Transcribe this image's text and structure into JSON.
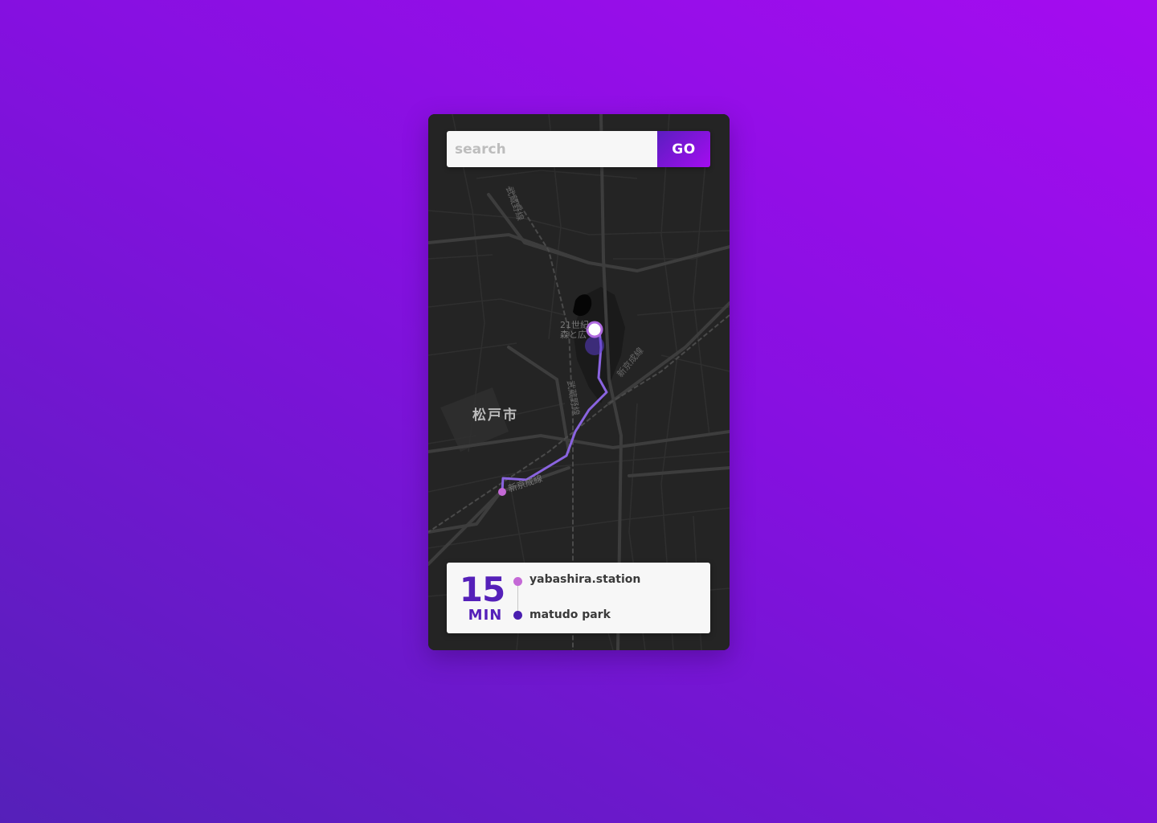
{
  "search": {
    "placeholder": "search",
    "value": "",
    "go_label": "GO"
  },
  "map": {
    "labels": {
      "city": "松戸市",
      "park": [
        "21世紀",
        "森と広"
      ],
      "rail_north": "武蔵野線",
      "rail_mid": "武蔵野線",
      "rail_east": "新京成線",
      "rail_south": "新京成線"
    },
    "colors": {
      "background": "#242424",
      "roads": "#3a3a3a",
      "route": "#8a64e0",
      "origin": "#c469d6",
      "destination": "#ffffff"
    }
  },
  "trip": {
    "duration_value": "15",
    "duration_unit": "MIN",
    "from": "yabashira.station",
    "to": "matudo park"
  },
  "colors": {
    "accent": "#5520b9",
    "accent_end": "#a40cf0",
    "panel": "#f7f7f7"
  }
}
